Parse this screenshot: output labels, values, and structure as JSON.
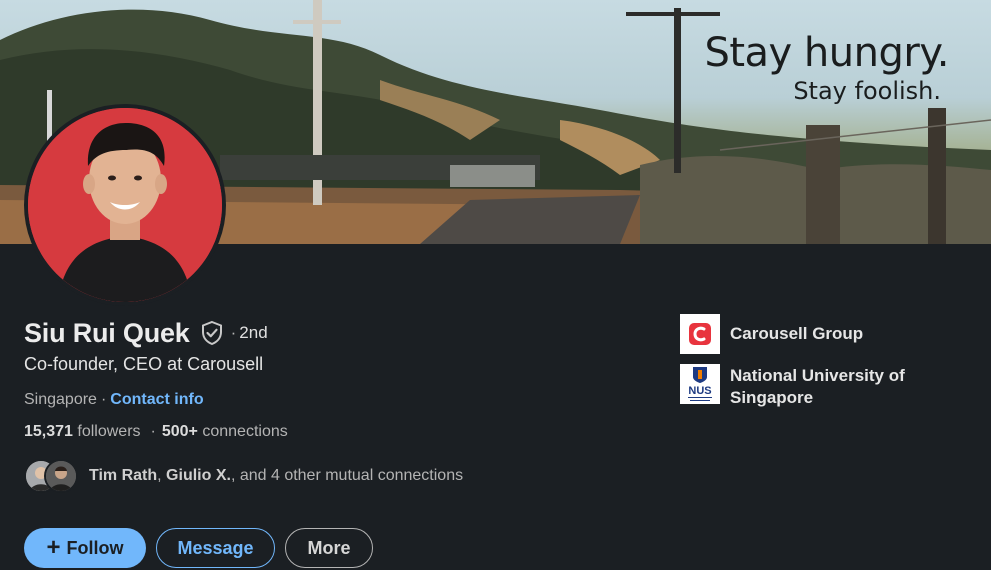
{
  "banner": {
    "quote_line1": "Stay hungry.",
    "quote_line2": "Stay foolish."
  },
  "profile": {
    "name": "Siu Rui Quek",
    "degree": "2nd",
    "headline": "Co-founder, CEO at Carousell",
    "location": "Singapore",
    "separator": "·",
    "contact_info": "Contact info",
    "followers_count": "15,371",
    "followers_label": "followers",
    "connections_count": "500+",
    "connections_label": "connections",
    "mutual": {
      "name1": "Tim Rath",
      "name2": "Giulio X.",
      "rest": ", and 4 other mutual connections"
    }
  },
  "actions": {
    "follow": "Follow",
    "message": "Message",
    "more": "More"
  },
  "orgs": [
    {
      "name": "Carousell Group",
      "logo_icon": "carousell-logo"
    },
    {
      "name": "National University of Singapore",
      "logo_text": "NUS",
      "logo_icon": "nus-crest-logo"
    }
  ],
  "colors": {
    "background": "#1b1f23",
    "accent": "#71b7fb",
    "avatar_bg": "#d63a3f",
    "carousell_red": "#e8343e",
    "nus_blue": "#1d3a82",
    "nus_orange": "#ef7c00"
  }
}
